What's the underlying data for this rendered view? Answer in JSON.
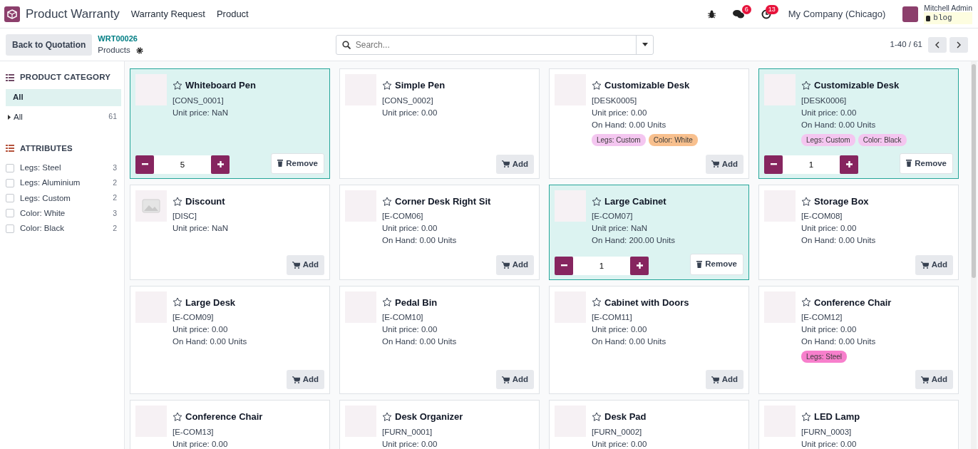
{
  "app": {
    "title": "Product Warranty",
    "menu": [
      "Warranty Request",
      "Product"
    ]
  },
  "systray": {
    "messages_count": "6",
    "activities_count": "13",
    "company": "My Company (Chicago)",
    "user": "Mitchell Admin",
    "database": "blog"
  },
  "control_panel": {
    "back_button": "Back to Quotation",
    "breadcrumb": "WRT00026",
    "title": "Products",
    "search": {
      "placeholder": "Search..."
    },
    "pager": "1-40 / 61"
  },
  "sidebar": {
    "category_heading": "PRODUCT CATEGORY",
    "categories": [
      {
        "label": "All",
        "selected": true,
        "expandable": false
      },
      {
        "label": "All",
        "count": "61",
        "selected": false,
        "expandable": true
      }
    ],
    "attribute_heading": "ATTRIBUTES",
    "attributes": [
      {
        "label": "Legs: Steel",
        "count": "3",
        "checked": false
      },
      {
        "label": "Legs: Aluminium",
        "count": "2",
        "checked": false
      },
      {
        "label": "Legs: Custom",
        "count": "2",
        "checked": false
      },
      {
        "label": "Color: White",
        "count": "3",
        "checked": false
      },
      {
        "label": "Color: Black",
        "count": "2",
        "checked": false
      }
    ]
  },
  "products": [
    {
      "name": "Whiteboard Pen",
      "code": "[CONS_0001]",
      "unit_price": "Unit price: NaN",
      "selected": true,
      "photo": true,
      "action": {
        "kind": "remove",
        "label": "Remove",
        "quantity": "5"
      }
    },
    {
      "name": "Simple Pen",
      "code": "[CONS_0002]",
      "unit_price": "Unit price: 0.00",
      "selected": false,
      "photo": true,
      "action": {
        "kind": "add",
        "label": "Add"
      }
    },
    {
      "name": "Customizable Desk",
      "code": "[DESK0005]",
      "unit_price": "Unit price: 0.00",
      "on_hand": "On Hand: 0.00 Units",
      "tags": [
        {
          "label": "Legs: Custom",
          "color": "#f4c6f0"
        },
        {
          "label": "Color: White",
          "color": "#f8c08e"
        }
      ],
      "selected": false,
      "photo": true,
      "action": {
        "kind": "add",
        "label": "Add"
      }
    },
    {
      "name": "Customizable Desk",
      "code": "[DESK0006]",
      "unit_price": "Unit price: 0.00",
      "on_hand": "On Hand: 0.00 Units",
      "tags": [
        {
          "label": "Legs: Custom",
          "color": "#f4c6f0"
        },
        {
          "label": "Color: Black",
          "color": "#f4c6f0"
        }
      ],
      "selected": true,
      "photo": true,
      "action": {
        "kind": "remove",
        "label": "Remove",
        "quantity": "1"
      }
    },
    {
      "name": "Discount",
      "code": "[DISC]",
      "unit_price": "Unit price: NaN",
      "selected": false,
      "photo": false,
      "action": {
        "kind": "add",
        "label": "Add"
      }
    },
    {
      "name": "Corner Desk Right Sit",
      "code": "[E-COM06]",
      "unit_price": "Unit price: 0.00",
      "on_hand": "On Hand: 0.00 Units",
      "selected": false,
      "photo": true,
      "action": {
        "kind": "add",
        "label": "Add"
      }
    },
    {
      "name": "Large Cabinet",
      "code": "[E-COM07]",
      "unit_price": "Unit price: NaN",
      "on_hand": "On Hand: 200.00 Units",
      "selected": true,
      "photo": true,
      "action": {
        "kind": "remove",
        "label": "Remove",
        "quantity": "1"
      }
    },
    {
      "name": "Storage Box",
      "code": "[E-COM08]",
      "unit_price": "Unit price: 0.00",
      "on_hand": "On Hand: 0.00 Units",
      "selected": false,
      "photo": true,
      "action": {
        "kind": "add",
        "label": "Add"
      }
    },
    {
      "name": "Large Desk",
      "code": "[E-COM09]",
      "unit_price": "Unit price: 0.00",
      "on_hand": "On Hand: 0.00 Units",
      "selected": false,
      "photo": true,
      "action": {
        "kind": "add",
        "label": "Add"
      }
    },
    {
      "name": "Pedal Bin",
      "code": "[E-COM10]",
      "unit_price": "Unit price: 0.00",
      "on_hand": "On Hand: 0.00 Units",
      "selected": false,
      "photo": true,
      "action": {
        "kind": "add",
        "label": "Add"
      }
    },
    {
      "name": "Cabinet with Doors",
      "code": "[E-COM11]",
      "unit_price": "Unit price: 0.00",
      "on_hand": "On Hand: 0.00 Units",
      "selected": false,
      "photo": true,
      "action": {
        "kind": "add",
        "label": "Add"
      }
    },
    {
      "name": "Conference Chair",
      "code": "[E-COM12]",
      "unit_price": "Unit price: 0.00",
      "on_hand": "On Hand: 0.00 Units",
      "tags": [
        {
          "label": "Legs: Steel",
          "color": "#f77fcc"
        }
      ],
      "selected": false,
      "photo": true,
      "action": {
        "kind": "add",
        "label": "Add"
      }
    },
    {
      "name": "Conference Chair",
      "code": "[E-COM13]",
      "unit_price": "Unit price: 0.00",
      "selected": false,
      "photo": true
    },
    {
      "name": "Desk Organizer",
      "code": "[FURN_0001]",
      "unit_price": "Unit price: 0.00",
      "selected": false,
      "photo": true
    },
    {
      "name": "Desk Pad",
      "code": "[FURN_0002]",
      "unit_price": "Unit price: 0.00",
      "selected": false,
      "photo": true
    },
    {
      "name": "LED Lamp",
      "code": "[FURN_0003]",
      "unit_price": "Unit price: 0.00",
      "selected": false,
      "photo": true
    }
  ]
}
